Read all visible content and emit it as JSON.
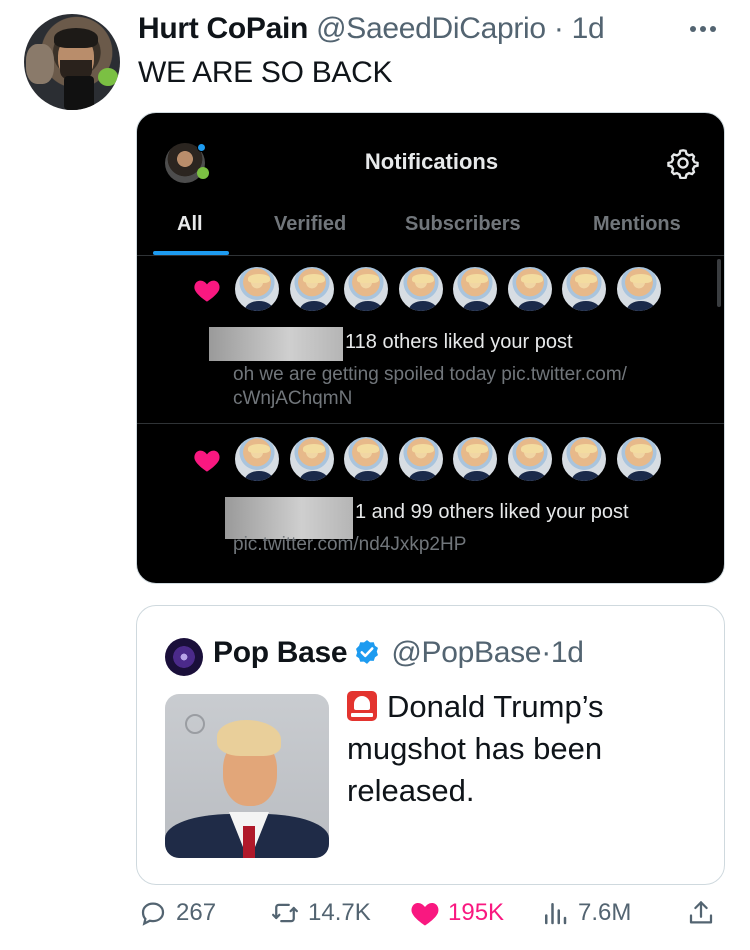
{
  "tweet": {
    "author_name": "Hurt CoPain",
    "author_handle": "@SaeedDiCaprio",
    "separator": "·",
    "time": "1d",
    "text": "WE ARE SO BACK"
  },
  "screenshot": {
    "title": "Notifications",
    "tabs": [
      "All",
      "Verified",
      "Subscribers",
      "Mentions"
    ],
    "active_tab": "All",
    "notifications": [
      {
        "line": "118 others liked your post",
        "sub": "oh we are getting spoiled today pic.twitter.com/ cWnjAChqmN"
      },
      {
        "line": "1 and 99 others liked your post",
        "sub": "pic.twitter.com/nd4Jxkp2HP"
      }
    ]
  },
  "quote": {
    "author_name": "Pop Base",
    "author_handle": "@PopBase",
    "separator": "·",
    "time": "1d",
    "text": "Donald Trump’s mugshot has been released."
  },
  "actions": {
    "replies": "267",
    "retweets": "14.7K",
    "likes": "195K",
    "views": "7.6M"
  },
  "colors": {
    "like": "#f91880",
    "verified": "#1d9bf0",
    "muted": "#536471"
  }
}
